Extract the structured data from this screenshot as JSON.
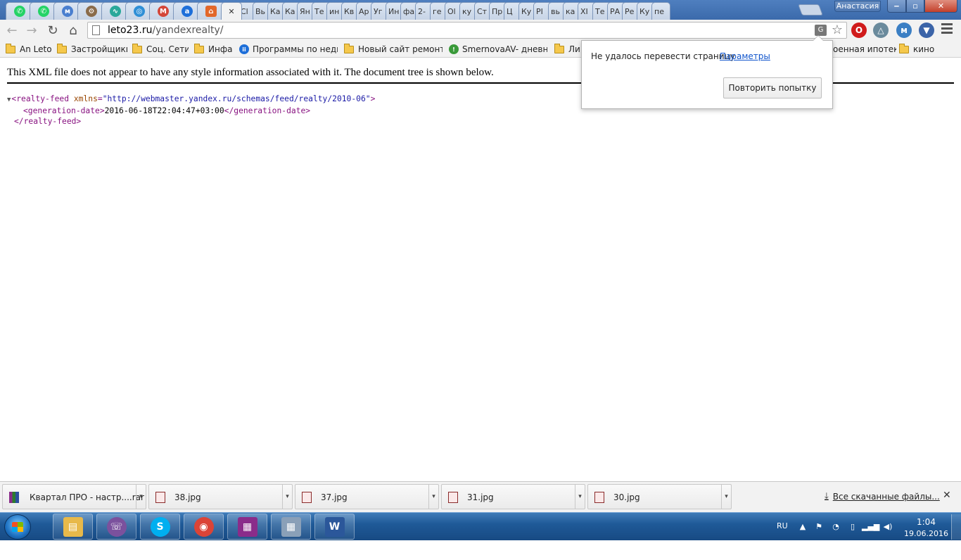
{
  "window": {
    "profile_name": "Анастасия",
    "minimize_glyph": "‒",
    "maximize_glyph": "▫",
    "close_glyph": "✕"
  },
  "tabs": {
    "icon_tabs": [
      {
        "name": "whatsapp-tab-icon",
        "glyph": "✆",
        "color": "#25d366"
      },
      {
        "name": "whatsapp-tab-icon-2",
        "glyph": "✆",
        "color": "#25d366"
      },
      {
        "name": "moy-mir-tab-icon",
        "glyph": "м",
        "color": "#4a7fcf"
      },
      {
        "name": "rocket-tab-icon",
        "glyph": "⚙",
        "color": "#8a6b4a"
      },
      {
        "name": "pulse-tab-icon",
        "glyph": "∿",
        "color": "#2aa89a"
      },
      {
        "name": "target-tab-icon",
        "glyph": "◎",
        "color": "#2f8fd6"
      },
      {
        "name": "gmail-tab-icon",
        "glyph": "M",
        "color": "#d44638"
      },
      {
        "name": "a-tab-icon",
        "glyph": "a",
        "color": "#1e6fd9"
      },
      {
        "name": "home-tab-icon",
        "glyph": "⌂",
        "color": "#e2672a"
      }
    ],
    "active_close": "✕",
    "text_tabs": [
      "Сl",
      "Вь",
      "Ка",
      "Ка",
      "Ян",
      "Те",
      "ин",
      "Кв",
      "Ар",
      "Уг",
      "Ин",
      "фа",
      "2-",
      "ге",
      "Ol",
      "ку",
      "Ст",
      "Пр",
      "Ц",
      "Ку",
      "PI",
      "вь",
      "ка",
      "XI",
      "Те",
      "РА",
      "Ре",
      "Ку",
      "пе"
    ]
  },
  "toolbar": {
    "back": "←",
    "forward": "→",
    "reload": "↻",
    "home": "⌂",
    "url_host": "leto23.ru",
    "url_path": "/yandexrealty/",
    "translate_icon": "G",
    "star": "☆",
    "extensions": [
      {
        "name": "opera-extension-icon",
        "glyph": "O",
        "color": "#d01b1b"
      },
      {
        "name": "triangle-extension-icon",
        "glyph": "△",
        "color": "#6a8a9c"
      },
      {
        "name": "moy-mir-extension-icon",
        "glyph": "м",
        "color": "#3b7fc4"
      },
      {
        "name": "shield-extension-icon",
        "glyph": "▼",
        "color": "#3b64a8"
      }
    ]
  },
  "bookmarks": [
    {
      "label": "An Leto",
      "type": "folder"
    },
    {
      "label": "Застройщики",
      "type": "folder"
    },
    {
      "label": "Соц. Сети",
      "type": "folder"
    },
    {
      "label": "Инфа",
      "type": "folder"
    },
    {
      "label": "Программы по недв",
      "type": "site",
      "color": "#1e6fd9",
      "glyph": "ii"
    },
    {
      "label": "Новый сайт ремонта",
      "type": "folder"
    },
    {
      "label": "SmernovaAV- дневни",
      "type": "site",
      "color": "#3a9a3a",
      "glyph": "!"
    },
    {
      "label": "Лич",
      "type": "folder"
    },
    {
      "label": "оенная ипотек",
      "type": "plain"
    },
    {
      "label": "кино",
      "type": "folder"
    }
  ],
  "content": {
    "notice": "This XML file does not appear to have any style information associated with it. The document tree is shown below.",
    "toggle": "▼",
    "root_open_tag": "<realty-feed",
    "root_attr_name": "xmlns",
    "root_attr_value": "\"http://webmaster.yandex.ru/schemas/feed/realty/2010-06\"",
    "root_open_end": ">",
    "gen_open": "<generation-date>",
    "gen_value": "2016-06-18T22:04:47+03:00",
    "gen_close": "</generation-date>",
    "root_close": "</realty-feed>"
  },
  "translate_bubble": {
    "message": "Не удалось перевести страницу",
    "link": "Параметры",
    "retry": "Повторить попытку"
  },
  "downloads": {
    "items": [
      {
        "name": "Квартал ПРО - настр....rar",
        "kind": "rar"
      },
      {
        "name": "38.jpg",
        "kind": "jpg"
      },
      {
        "name": "37.jpg",
        "kind": "jpg"
      },
      {
        "name": "31.jpg",
        "kind": "jpg"
      },
      {
        "name": "30.jpg",
        "kind": "jpg"
      }
    ],
    "dropdown": "▾",
    "all_label": "Все скачанные файлы...",
    "all_arrow": "⤓",
    "close": "✕"
  },
  "taskbar": {
    "apps": [
      {
        "name": "explorer-taskbar-icon",
        "glyph": "▤",
        "color": "#e8b94a"
      },
      {
        "name": "viber-taskbar-icon",
        "glyph": "☏",
        "color": "#7b519d"
      },
      {
        "name": "skype-taskbar-icon",
        "glyph": "S",
        "color": "#00aff0"
      },
      {
        "name": "chrome-taskbar-icon",
        "glyph": "◉",
        "color": "#db4437"
      },
      {
        "name": "winrar-taskbar-icon",
        "glyph": "▦",
        "color": "#8a2c8a"
      },
      {
        "name": "calculator-taskbar-icon",
        "glyph": "▦",
        "color": "#8aa0b8"
      },
      {
        "name": "word-taskbar-icon",
        "glyph": "W",
        "color": "#2b579a"
      }
    ],
    "language": "RU",
    "tray_up": "▲",
    "tray_flag": "⚑",
    "tray_sync": "◔",
    "tray_battery": "▯",
    "tray_signal": "▂▄▆",
    "tray_volume": "◀)",
    "time": "1:04",
    "date": "19.06.2016"
  }
}
